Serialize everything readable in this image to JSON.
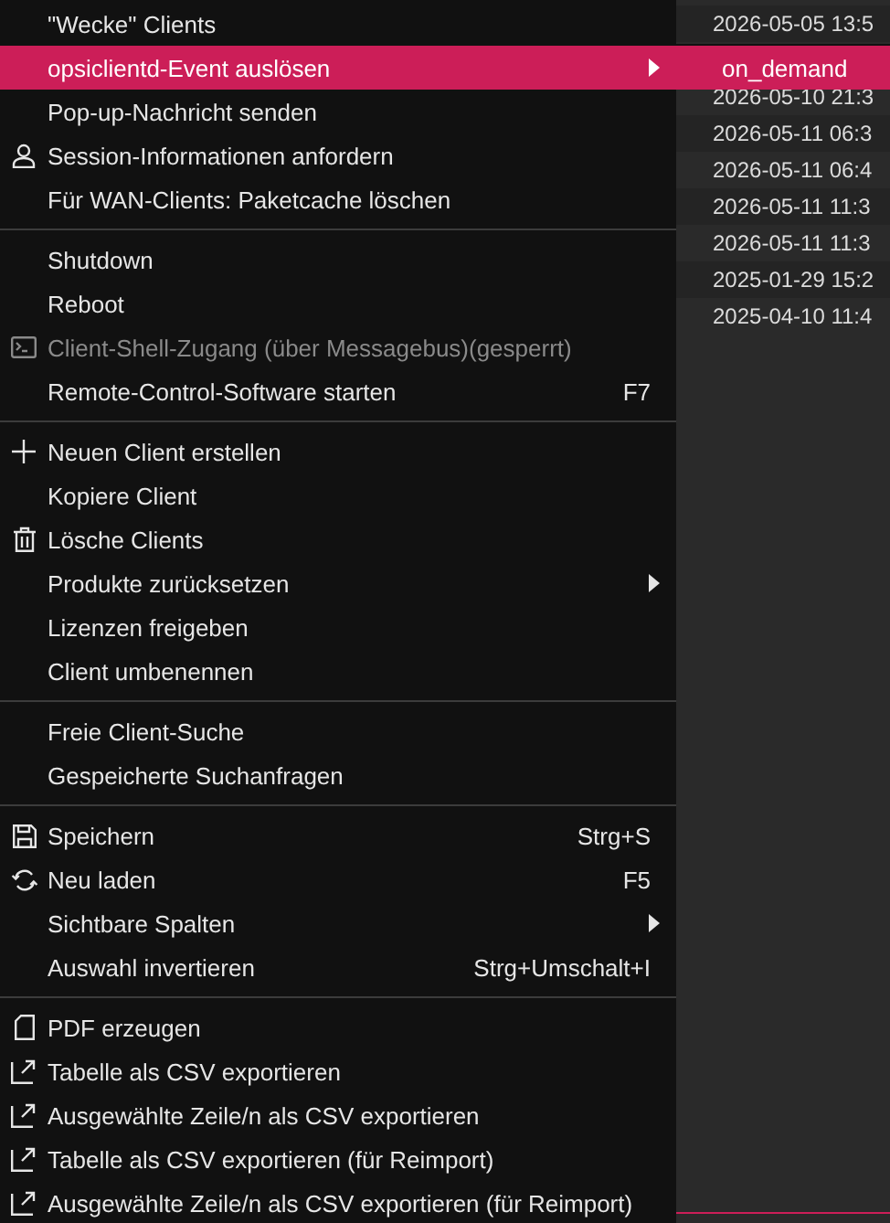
{
  "menu": {
    "items": [
      {
        "kind": "item",
        "label": "\"Wecke\" Clients",
        "selected": false,
        "disabled": false,
        "submenu": false
      },
      {
        "kind": "item",
        "label": "opsiclientd-Event auslösen",
        "selected": true,
        "disabled": false,
        "submenu": true
      },
      {
        "kind": "item",
        "label": "Pop-up-Nachricht senden",
        "selected": false,
        "disabled": false,
        "submenu": false
      },
      {
        "kind": "item",
        "label": "Session-Informationen anfordern",
        "selected": false,
        "disabled": false,
        "submenu": false
      },
      {
        "kind": "item",
        "label": "Für WAN-Clients: Paketcache löschen",
        "selected": false,
        "disabled": false,
        "submenu": false
      },
      {
        "kind": "separator"
      },
      {
        "kind": "item",
        "label": "Shutdown",
        "selected": false,
        "disabled": false,
        "submenu": false
      },
      {
        "kind": "item",
        "label": "Reboot",
        "selected": false,
        "disabled": false,
        "submenu": false
      },
      {
        "kind": "item",
        "label": "Client-Shell-Zugang (über Messagebus)(gesperrt)",
        "selected": false,
        "disabled": true,
        "submenu": false
      },
      {
        "kind": "item",
        "label": "Remote-Control-Software starten",
        "shortcut": "F7",
        "selected": false,
        "disabled": false,
        "submenu": false
      },
      {
        "kind": "separator"
      },
      {
        "kind": "item",
        "label": "Neuen Client erstellen",
        "selected": false,
        "disabled": false,
        "submenu": false
      },
      {
        "kind": "item",
        "label": "Kopiere Client",
        "selected": false,
        "disabled": false,
        "submenu": false
      },
      {
        "kind": "item",
        "label": "Lösche Clients",
        "selected": false,
        "disabled": false,
        "submenu": false
      },
      {
        "kind": "item",
        "label": "Produkte zurücksetzen",
        "selected": false,
        "disabled": false,
        "submenu": true
      },
      {
        "kind": "item",
        "label": "Lizenzen freigeben",
        "selected": false,
        "disabled": false,
        "submenu": false
      },
      {
        "kind": "item",
        "label": "Client umbenennen",
        "selected": false,
        "disabled": false,
        "submenu": false
      },
      {
        "kind": "separator"
      },
      {
        "kind": "item",
        "label": "Freie Client-Suche",
        "selected": false,
        "disabled": false,
        "submenu": false
      },
      {
        "kind": "item",
        "label": "Gespeicherte Suchanfragen",
        "selected": false,
        "disabled": false,
        "submenu": false
      },
      {
        "kind": "separator"
      },
      {
        "kind": "item",
        "label": "Speichern",
        "shortcut": "Strg+S",
        "selected": false,
        "disabled": false,
        "submenu": false
      },
      {
        "kind": "item",
        "label": "Neu laden",
        "shortcut": "F5",
        "selected": false,
        "disabled": false,
        "submenu": false
      },
      {
        "kind": "item",
        "label": "Sichtbare Spalten",
        "selected": false,
        "disabled": false,
        "submenu": true
      },
      {
        "kind": "item",
        "label": "Auswahl invertieren",
        "shortcut": "Strg+Umschalt+I",
        "selected": false,
        "disabled": false,
        "submenu": false
      },
      {
        "kind": "separator"
      },
      {
        "kind": "item",
        "label": "PDF erzeugen",
        "selected": false,
        "disabled": false,
        "submenu": false
      },
      {
        "kind": "item",
        "label": "Tabelle als CSV exportieren",
        "selected": false,
        "disabled": false,
        "submenu": false
      },
      {
        "kind": "item",
        "label": "Ausgewählte Zeile/n als CSV exportieren",
        "selected": false,
        "disabled": false,
        "submenu": false
      },
      {
        "kind": "item",
        "label": "Tabelle als CSV exportieren (für Reimport)",
        "selected": false,
        "disabled": false,
        "submenu": false
      },
      {
        "kind": "item",
        "label": "Ausgewählte Zeile/n als CSV exportieren (für Reimport)",
        "selected": false,
        "disabled": false,
        "submenu": false
      }
    ]
  },
  "submenu": {
    "items": [
      {
        "label": "on_demand",
        "selected": true
      }
    ]
  },
  "table": {
    "rows": [
      {
        "cell": "2026-05-05 13:5"
      },
      {
        "cell": "2026-05-10 21:3"
      },
      {
        "cell": "2026-05-11 06:3"
      },
      {
        "cell": "2026-05-11 06:4"
      },
      {
        "cell": "2026-05-11 11:3"
      },
      {
        "cell": "2026-05-11 11:3"
      },
      {
        "cell": "2025-01-29 15:2"
      },
      {
        "cell": "2025-04-10 11:4"
      }
    ]
  }
}
